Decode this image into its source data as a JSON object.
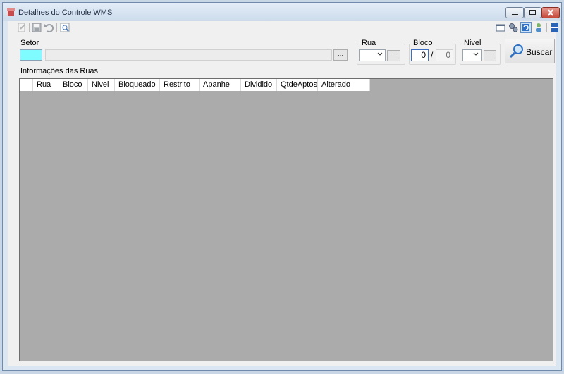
{
  "window": {
    "title": "Detalhes do Controle WMS"
  },
  "filters": {
    "setor_label": "Setor",
    "rua_label": "Rua",
    "bloco_label": "Bloco",
    "nivel_label": "Nivel",
    "browse_label": "...",
    "bloco_from": "0",
    "bloco_separator": "/",
    "bloco_to": "0",
    "setor_color": "#7ffcff"
  },
  "search_button": {
    "label": "Buscar"
  },
  "grid": {
    "section_label": "Informações das Ruas",
    "columns": [
      "Rua",
      "Bloco",
      "Nivel",
      "Bloqueado",
      "Restrito",
      "Apanhe",
      "Dividido",
      "QtdeAptos",
      "Alterado"
    ]
  }
}
